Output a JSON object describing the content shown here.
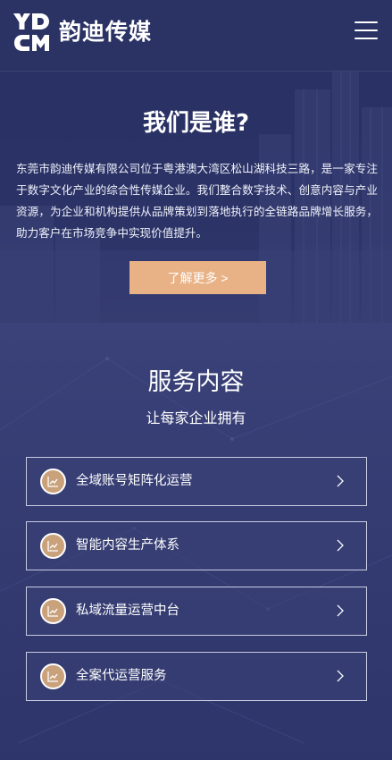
{
  "header": {
    "logo_text": "韵迪传媒",
    "logo_icon": "ydcm-logo-mark",
    "menu_icon": "hamburger-menu-icon"
  },
  "about": {
    "title": "我们是谁?",
    "description": "东莞市韵迪传媒有限公司位于粤港澳大湾区松山湖科技三路，是一家专注于数字文化产业的综合性传媒企业。我们整合数字技术、创意内容与产业资源，为企业和机构提供从品牌策划到落地执行的全链路品牌增长服务，助力客户在市场竞争中实现价值提升。",
    "more_button": "了解更多 >"
  },
  "services": {
    "title": "服务内容",
    "subtitle": "让每家企业拥有",
    "items": [
      {
        "label": "全域账号矩阵化运营",
        "icon": "chart-line-icon"
      },
      {
        "label": "智能内容生产体系",
        "icon": "chart-line-icon"
      },
      {
        "label": "私域流量运营中台",
        "icon": "chart-line-icon"
      },
      {
        "label": "全案代运营服务",
        "icon": "chart-line-icon"
      }
    ]
  },
  "colors": {
    "header_bg": "#2b3365",
    "accent": "#e8b286",
    "icon_bg": "#c9a27c",
    "border": "#c7cbe2"
  }
}
